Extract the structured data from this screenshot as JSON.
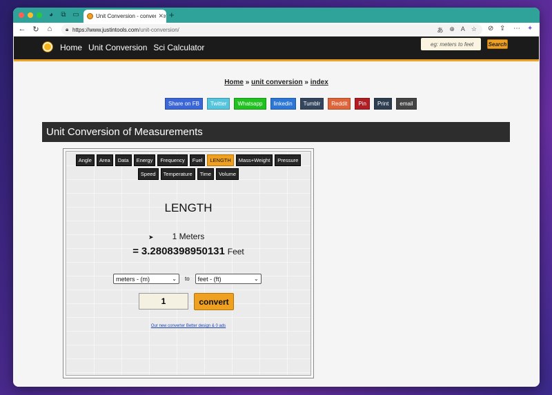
{
  "browser": {
    "tab_title": "Unit Conversion - convert betw",
    "url_host": "https://www.justintools.com",
    "url_path": "/unit-conversion/",
    "new_tab": "+",
    "tab_close": "✕"
  },
  "site": {
    "menu": [
      "Home",
      "Unit Conversion",
      "Sci Calculator"
    ],
    "search_placeholder": "eg: meters to feet",
    "search_button": "Search"
  },
  "breadcrumb": {
    "home": "Home",
    "sep": "»",
    "unit": "unit conversion",
    "index": "index"
  },
  "share_buttons": [
    {
      "label": "Share on FB",
      "color": "#3b66d8"
    },
    {
      "label": "Twitter",
      "color": "#55c4dd"
    },
    {
      "label": "Whatsapp",
      "color": "#1fc21f"
    },
    {
      "label": "linkedin",
      "color": "#2b76d6"
    },
    {
      "label": "Tumblr",
      "color": "#34465d"
    },
    {
      "label": "Reddit",
      "color": "#e0643a"
    },
    {
      "label": "Pin",
      "color": "#b01e23"
    },
    {
      "label": "Print",
      "color": "#2d3e50"
    },
    {
      "label": "email",
      "color": "#444444"
    }
  ],
  "heading": "Unit Conversion of Measurements",
  "converter": {
    "categories": [
      "Angle",
      "Area",
      "Data",
      "Energy",
      "Frequency",
      "Fuel",
      "LENGTH",
      "Mass+Weight",
      "Pressure",
      "Speed",
      "Temperature",
      "Time",
      "Volume"
    ],
    "active_category": "LENGTH",
    "title": "LENGTH",
    "from_text": "1 Meters",
    "equals": "=",
    "result_value": "3.2808398950131",
    "result_unit": "Feet",
    "from_select": "meters - (m)",
    "to_label": "to",
    "to_select": "feet - (ft)",
    "input_value": "1",
    "convert_button": "convert",
    "new_converter_link": "Our new converter Better design & 0 ads"
  }
}
